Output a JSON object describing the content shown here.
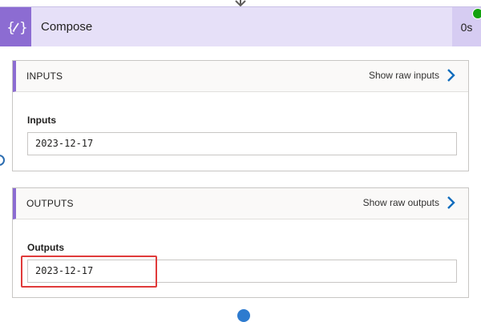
{
  "header": {
    "title": "Compose",
    "duration": "0s",
    "icon": "compose-icon",
    "accent_color": "#8c6cd2",
    "status_color": "#13a10e"
  },
  "inputs": {
    "section_title": "INPUTS",
    "raw_link": "Show raw inputs",
    "field_label": "Inputs",
    "value": "2023-12-17"
  },
  "outputs": {
    "section_title": "OUTPUTS",
    "raw_link": "Show raw outputs",
    "field_label": "Outputs",
    "value": "2023-12-17"
  },
  "annotation": {
    "highlight_color": "#e03a3a"
  }
}
